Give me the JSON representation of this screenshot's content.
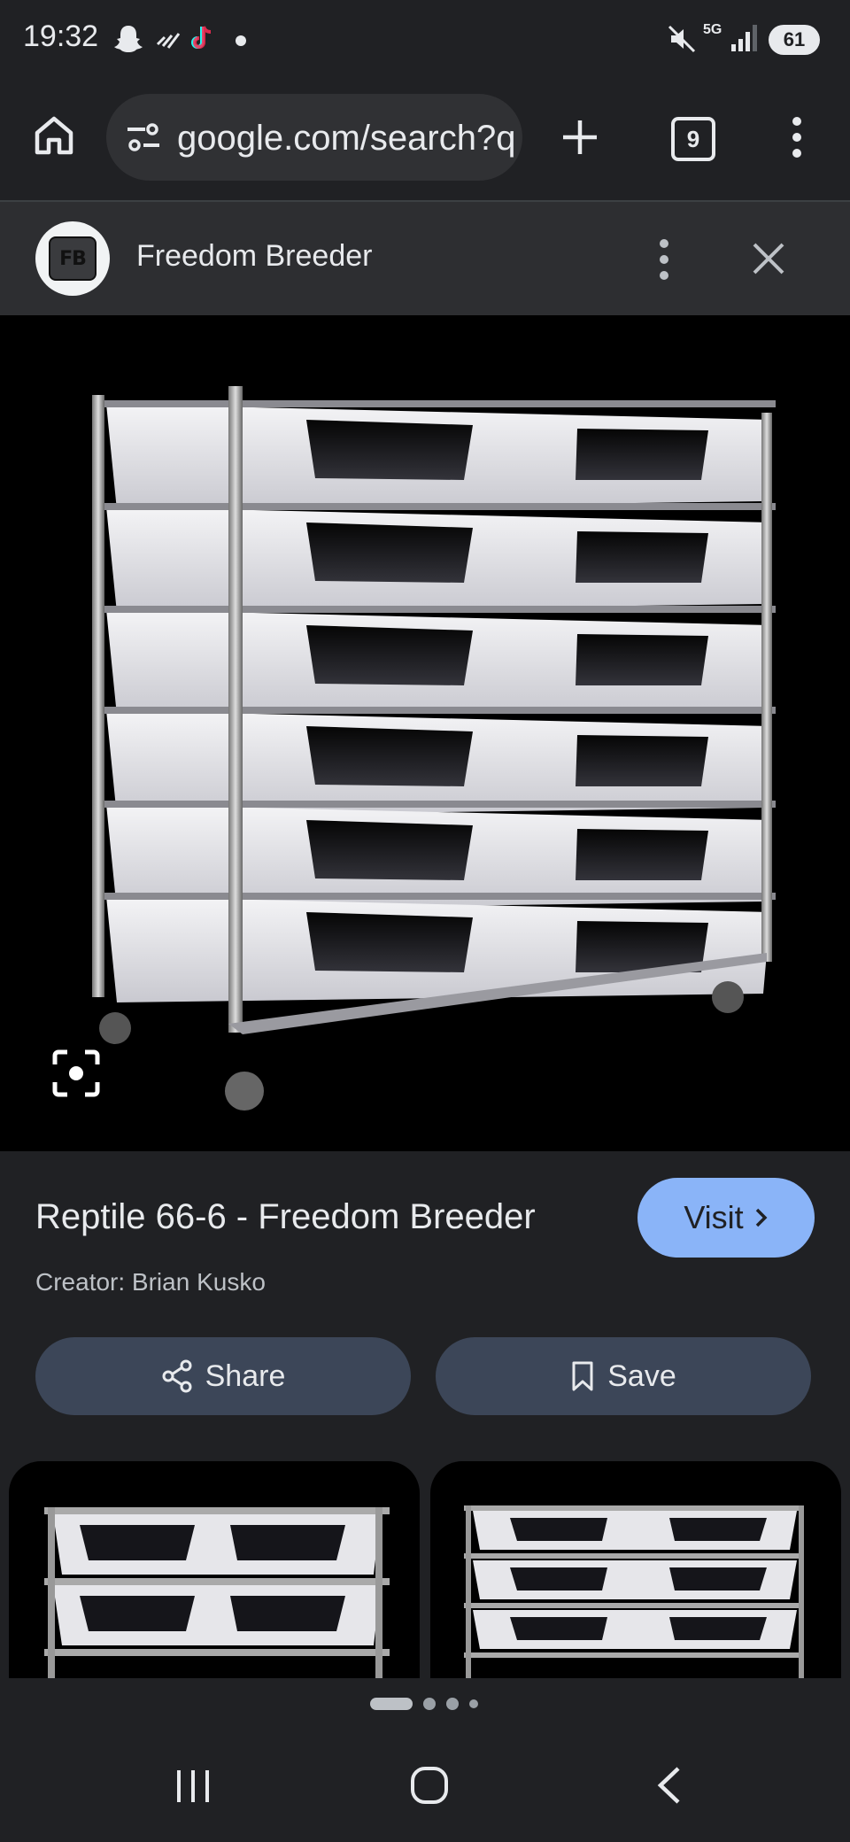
{
  "status_bar": {
    "time": "19:32",
    "battery": "61",
    "network": "5G",
    "icons": [
      "snapchat-icon",
      "signal-strength-icon",
      "tiktok-icon",
      "dot-icon",
      "mute-icon",
      "5g-icon",
      "signal-bars-icon",
      "battery-icon"
    ]
  },
  "browser": {
    "url": "google.com/search?q",
    "tab_count": "9",
    "icons": [
      "home-icon",
      "site-settings-icon",
      "new-tab-icon",
      "tab-switcher-icon",
      "more-menu-icon"
    ]
  },
  "panel": {
    "source_name": "Freedom Breeder",
    "logo_text": "FB",
    "icons": [
      "more-options-icon",
      "close-icon"
    ]
  },
  "result": {
    "title": "Reptile 66-6 - Freedom Breeder",
    "visit_label": "Visit",
    "creator": "Creator: Brian Kusko",
    "share_label": "Share",
    "save_label": "Save"
  },
  "colors": {
    "background": "#202124",
    "panel": "#2d2e31",
    "accent_button": "#8ab4f8",
    "action_button": "#3c4658"
  }
}
